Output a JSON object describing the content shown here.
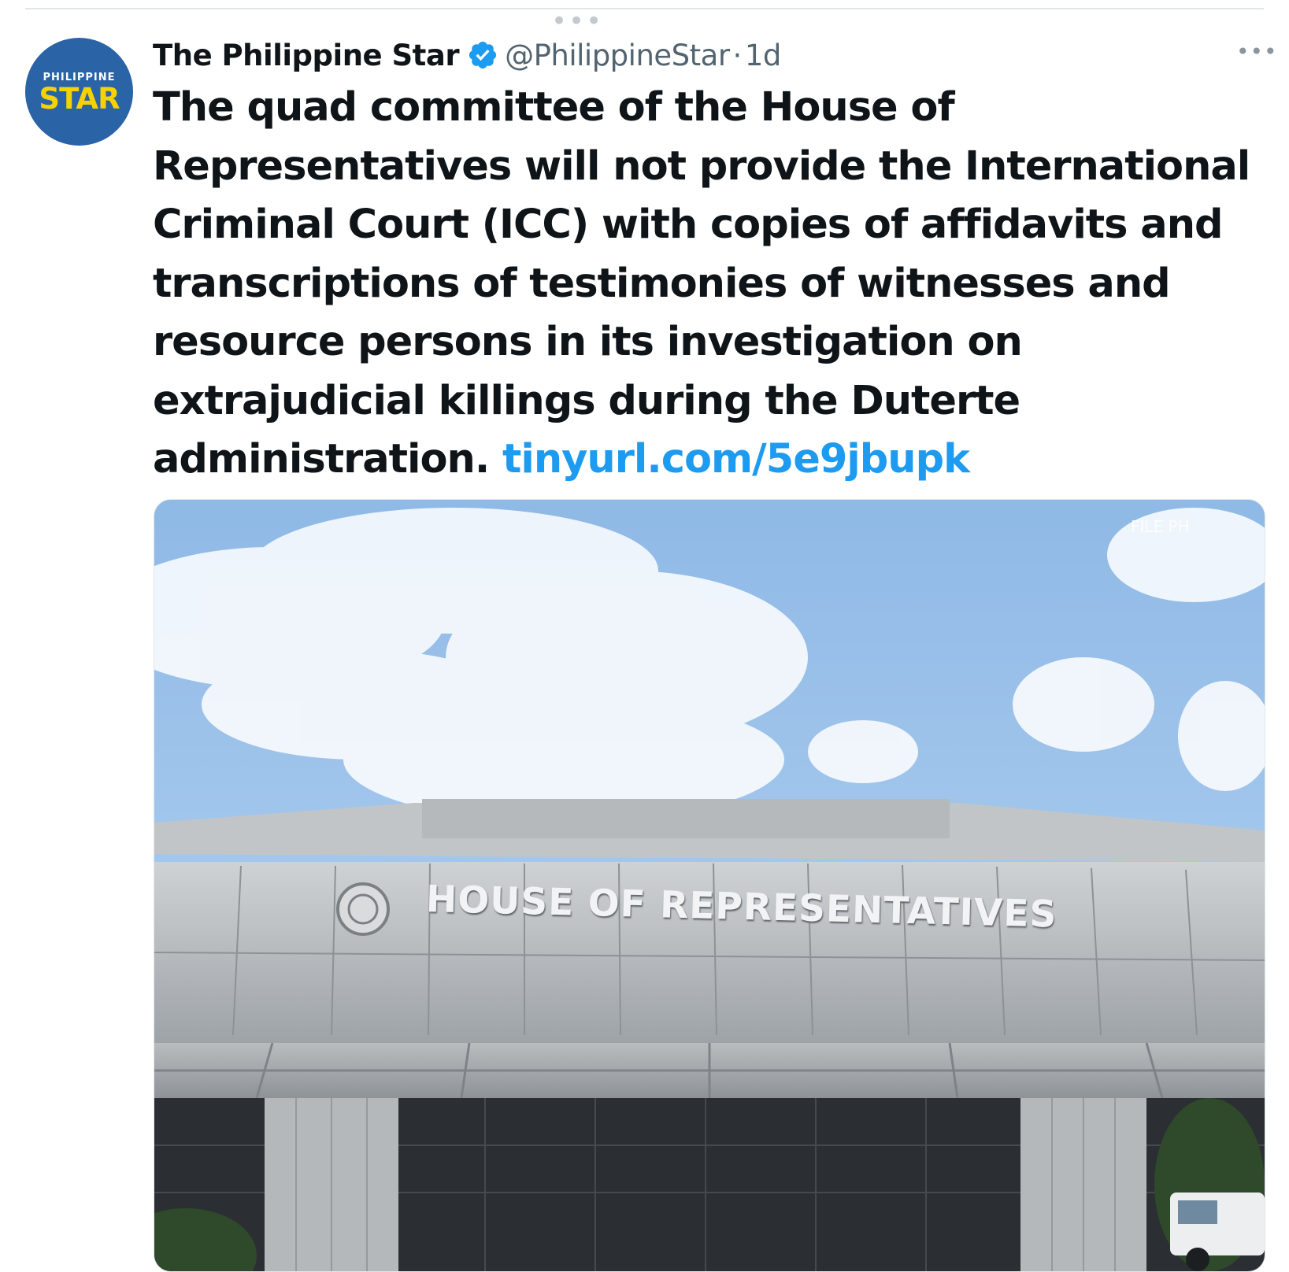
{
  "author": {
    "name": "The Philippine Star",
    "handle": "@PhilippineStar",
    "separator": "·",
    "time": "1d",
    "verified": true
  },
  "avatar": {
    "small_text": "PHILIPPINE",
    "big_text": "STAR"
  },
  "tweet": {
    "text": "The quad committee of the House of Representatives will not provide the International Criminal Court (ICC) with copies of affidavits and transcriptions of testimonies of witnesses and resource persons in its investigation on extrajudicial killings during the Duterte administration.",
    "link": "tinyurl.com/5e9jbupk"
  },
  "media": {
    "watermark": "FILE PH",
    "sign_text": "HOUSE OF REPRESENTATIVES"
  },
  "icons": {
    "thread": "ellipsis-icon",
    "verified": "verified-badge-icon",
    "more": "more-options-icon"
  },
  "colors": {
    "link": "#1d9bf0",
    "verified": "#1d9bf0",
    "avatar_bg": "#2a63a6",
    "avatar_accent": "#f6d200",
    "text_primary": "#0f1419",
    "text_secondary": "#536471"
  }
}
